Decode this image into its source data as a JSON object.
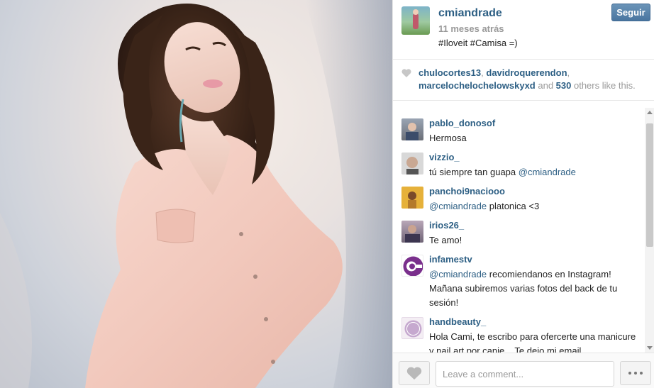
{
  "post": {
    "username": "cmiandrade",
    "time": "11 meses atrás",
    "caption": "#Iloveit #Camisa =)",
    "follow_label": "Seguir"
  },
  "likes": {
    "users": [
      "chulocortes13",
      "davidroquerendon",
      "marcelochelochelowskyxd"
    ],
    "sep1": ", ",
    "sep2": ",",
    "and_text": " and ",
    "count": "530",
    "suffix": " others like this."
  },
  "comments": [
    {
      "user": "pablo_donosof",
      "text": "Hermosa",
      "mention": ""
    },
    {
      "user": "vizzio_",
      "text": "tú siempre tan guapa ",
      "mention": "@cmiandrade"
    },
    {
      "user": "panchoi9naciooo",
      "mention": "@cmiandrade",
      "text": " platonica <3"
    },
    {
      "user": "irios26_",
      "text": "Te amo!",
      "mention": ""
    },
    {
      "user": "infamestv",
      "mention": "@cmiandrade",
      "text": " recomiendanos en Instagram! Mañana subiremos varias fotos del back de tu sesión!"
    },
    {
      "user": "handbeauty_",
      "text": "Hola Cami, te escribo para ofercerte una manicure y nail art por canje... Te dejo mi email",
      "mention": ""
    }
  ],
  "footer": {
    "comment_placeholder": "Leave a comment..."
  },
  "icons": {
    "heart": "heart-icon",
    "more": "more-icon"
  },
  "colors": {
    "username_blue": "#2d5f84",
    "follow_button": "#4a76a0"
  }
}
